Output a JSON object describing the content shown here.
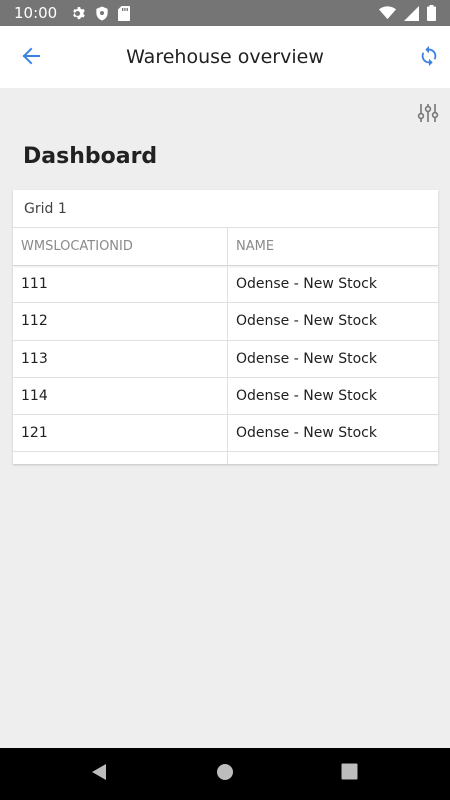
{
  "status_bar": {
    "time": "10:00",
    "icons": [
      "gear-icon",
      "shield-icon",
      "sd-card-icon",
      "wifi-icon",
      "signal-icon",
      "battery-icon"
    ]
  },
  "app_bar": {
    "title": "Warehouse overview",
    "back_icon": "arrow-left-icon",
    "refresh_icon": "refresh-icon",
    "accent_color": "#3b82e6"
  },
  "toolbar": {
    "filter_icon": "sliders-icon"
  },
  "page": {
    "heading": "Dashboard"
  },
  "grid": {
    "title": "Grid 1",
    "columns": [
      "WMSLOCATIONID",
      "NAME"
    ],
    "rows": [
      [
        "111",
        "Odense - New Stock"
      ],
      [
        "112",
        "Odense - New Stock"
      ],
      [
        "113",
        "Odense - New Stock"
      ],
      [
        "114",
        "Odense - New Stock"
      ],
      [
        "121",
        "Odense - New Stock"
      ],
      [
        "",
        ""
      ]
    ]
  },
  "nav_bar": {
    "icons": [
      "back-triangle-icon",
      "home-circle-icon",
      "recents-square-icon"
    ]
  }
}
